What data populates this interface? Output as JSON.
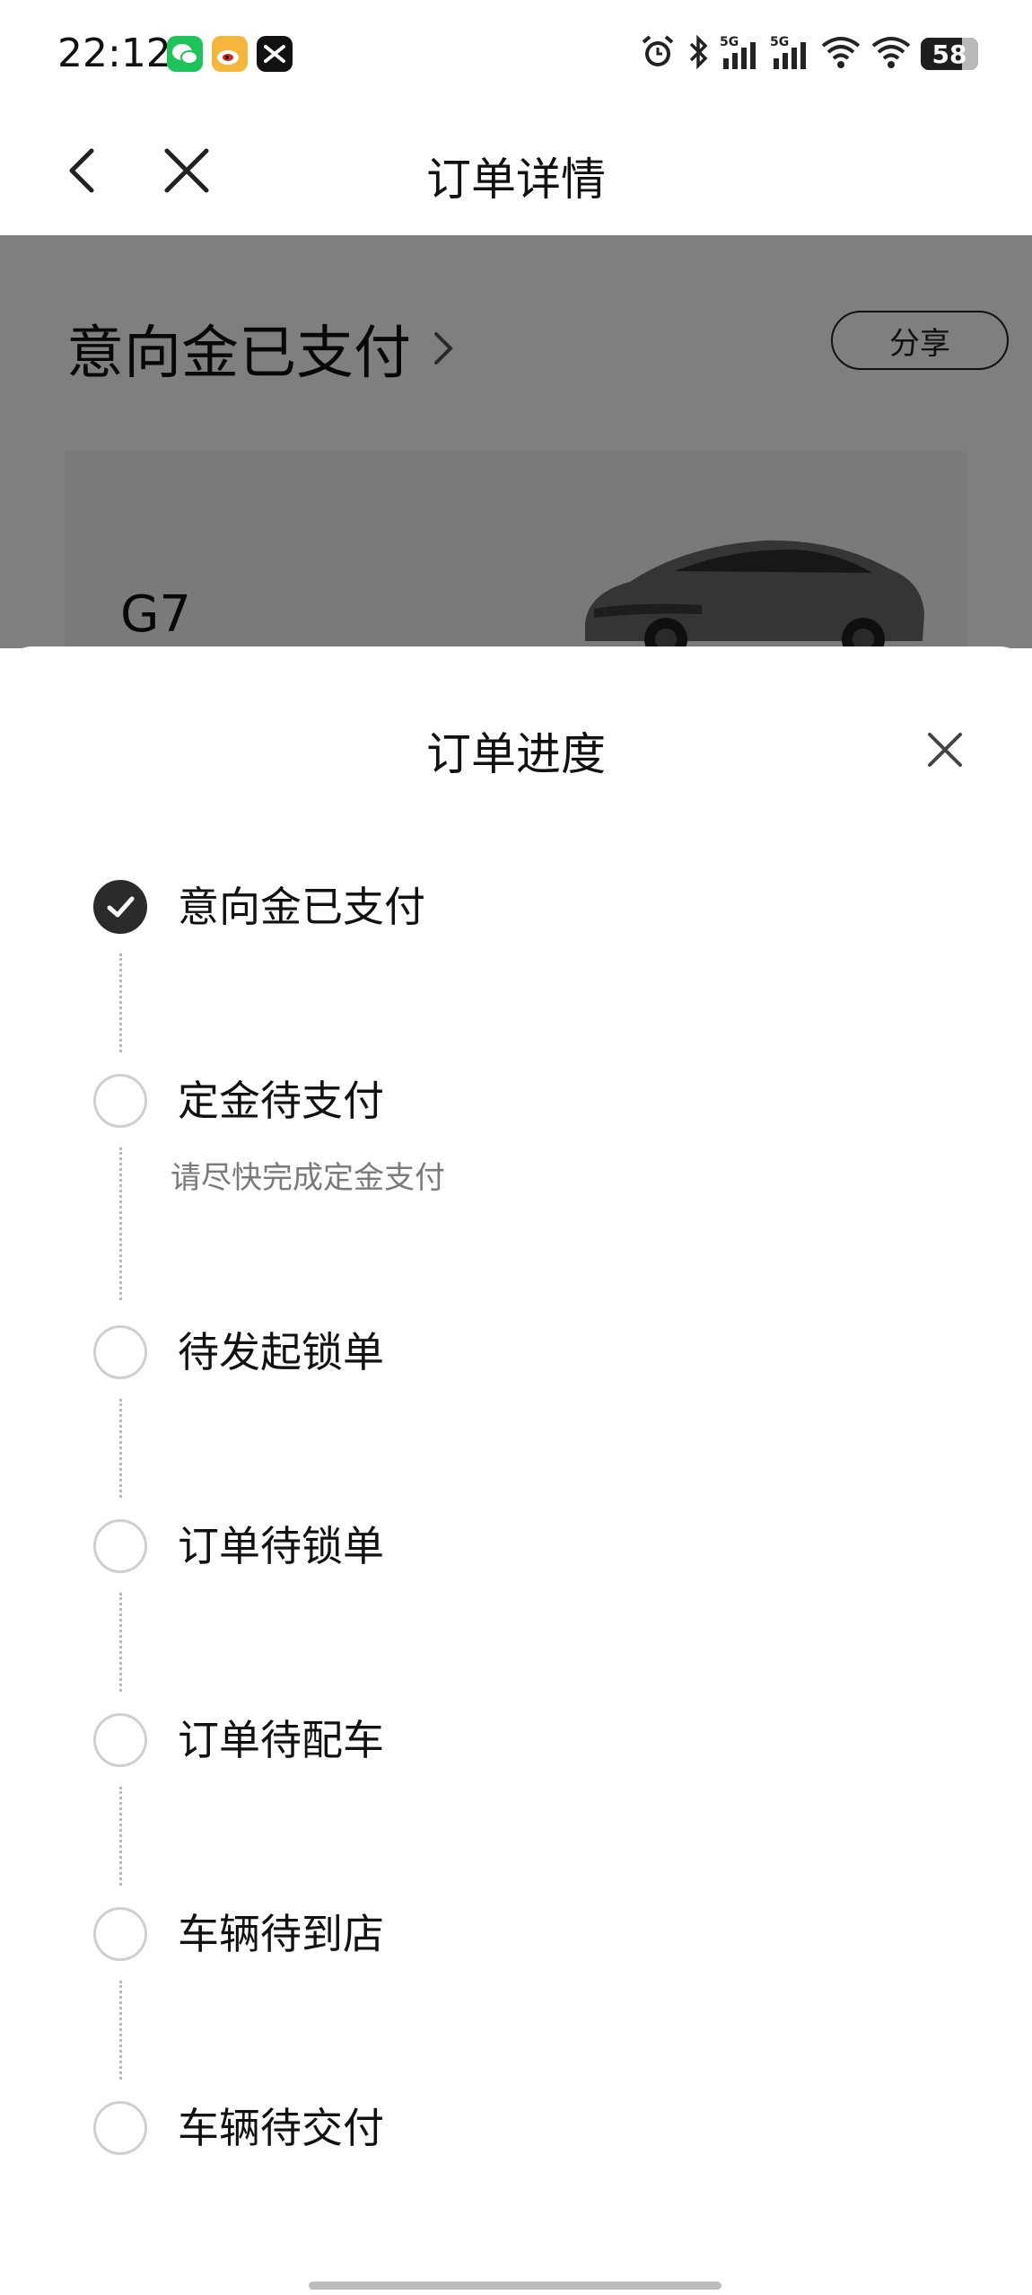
{
  "status_bar": {
    "time": "22:12",
    "apps": [
      "wechat-icon",
      "weibo-icon",
      "capcut-icon"
    ],
    "indicators": [
      "alarm-icon",
      "bluetooth-icon",
      "signal-5g-1-icon",
      "signal-5g-2-icon",
      "wifi-1-icon",
      "wifi-2-icon"
    ],
    "battery": "58"
  },
  "nav": {
    "title": "订单详情"
  },
  "page": {
    "status_title": "意向金已支付",
    "share_label": "分享",
    "car_model": "G7"
  },
  "sheet": {
    "title": "订单进度",
    "steps": [
      {
        "label": "意向金已支付",
        "done": true
      },
      {
        "label": "定金待支付",
        "sub": "请尽快完成定金支付",
        "done": false
      },
      {
        "label": "待发起锁单",
        "done": false
      },
      {
        "label": "订单待锁单",
        "done": false
      },
      {
        "label": "订单待配车",
        "done": false
      },
      {
        "label": "车辆待到店",
        "done": false
      },
      {
        "label": "车辆待交付",
        "done": false
      }
    ]
  },
  "colors": {
    "accent_dark": "#2b2b2b",
    "muted_text": "#7a7a7a",
    "overlay": "rgba(0,0,0,0.5)",
    "wechat_green": "#1ec35a",
    "weibo_yellow": "#f5b73b"
  }
}
